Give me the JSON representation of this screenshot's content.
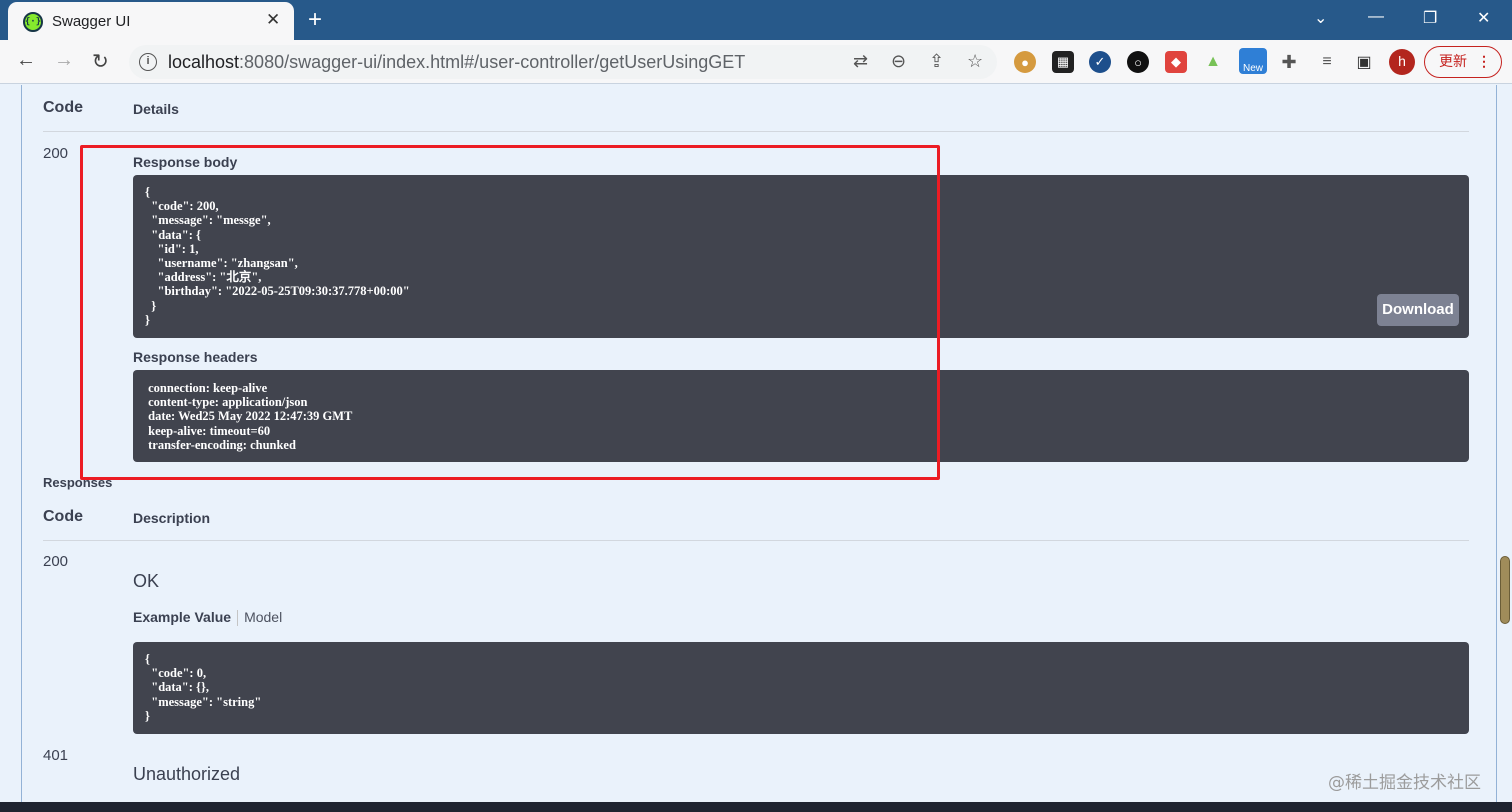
{
  "browser": {
    "tab_title": "Swagger UI",
    "tab_favicon_glyph": "{·}",
    "close_glyph": "✕",
    "new_tab_glyph": "+",
    "url_host": "localhost",
    "url_rest": ":8080/swagger-ui/index.html#/user-controller/getUserUsingGET",
    "avatar_letter": "h",
    "update_label": "更新",
    "update_menu_glyph": "⋮",
    "ext_new_badge": "New"
  },
  "response_table": {
    "col_code": "Code",
    "col_details": "Details",
    "status": "200",
    "body_title": "Response body",
    "body_text": "{\n  \"code\": 200,\n  \"message\": \"messge\",\n  \"data\": {\n    \"id\": 1,\n    \"username\": \"zhangsan\",\n    \"address\": \"北京\",\n    \"birthday\": \"2022-05-25T09:30:37.778+00:00\"\n  }\n}",
    "download_label": "Download",
    "headers_title": "Response headers",
    "headers_text": " connection: keep-alive \n content-type: application/json \n date: Wed25 May 2022 12:47:39 GMT \n keep-alive: timeout=60 \n transfer-encoding: chunked "
  },
  "responses": {
    "title": "Responses",
    "col_code": "Code",
    "col_description": "Description",
    "items": [
      {
        "code": "200",
        "description": "OK",
        "tab_example": "Example Value",
        "tab_model": "Model",
        "example": "{\n  \"code\": 0,\n  \"data\": {},\n  \"message\": \"string\"\n}"
      },
      {
        "code": "401",
        "description": "Unauthorized"
      }
    ]
  },
  "watermark": "@稀土掘金技术社区",
  "colors": {
    "tabbar": "#27598a",
    "page_bg": "#eaf2fb",
    "codebox": "#41444e",
    "highlight": "#ec1c24",
    "update": "#c5221f"
  }
}
